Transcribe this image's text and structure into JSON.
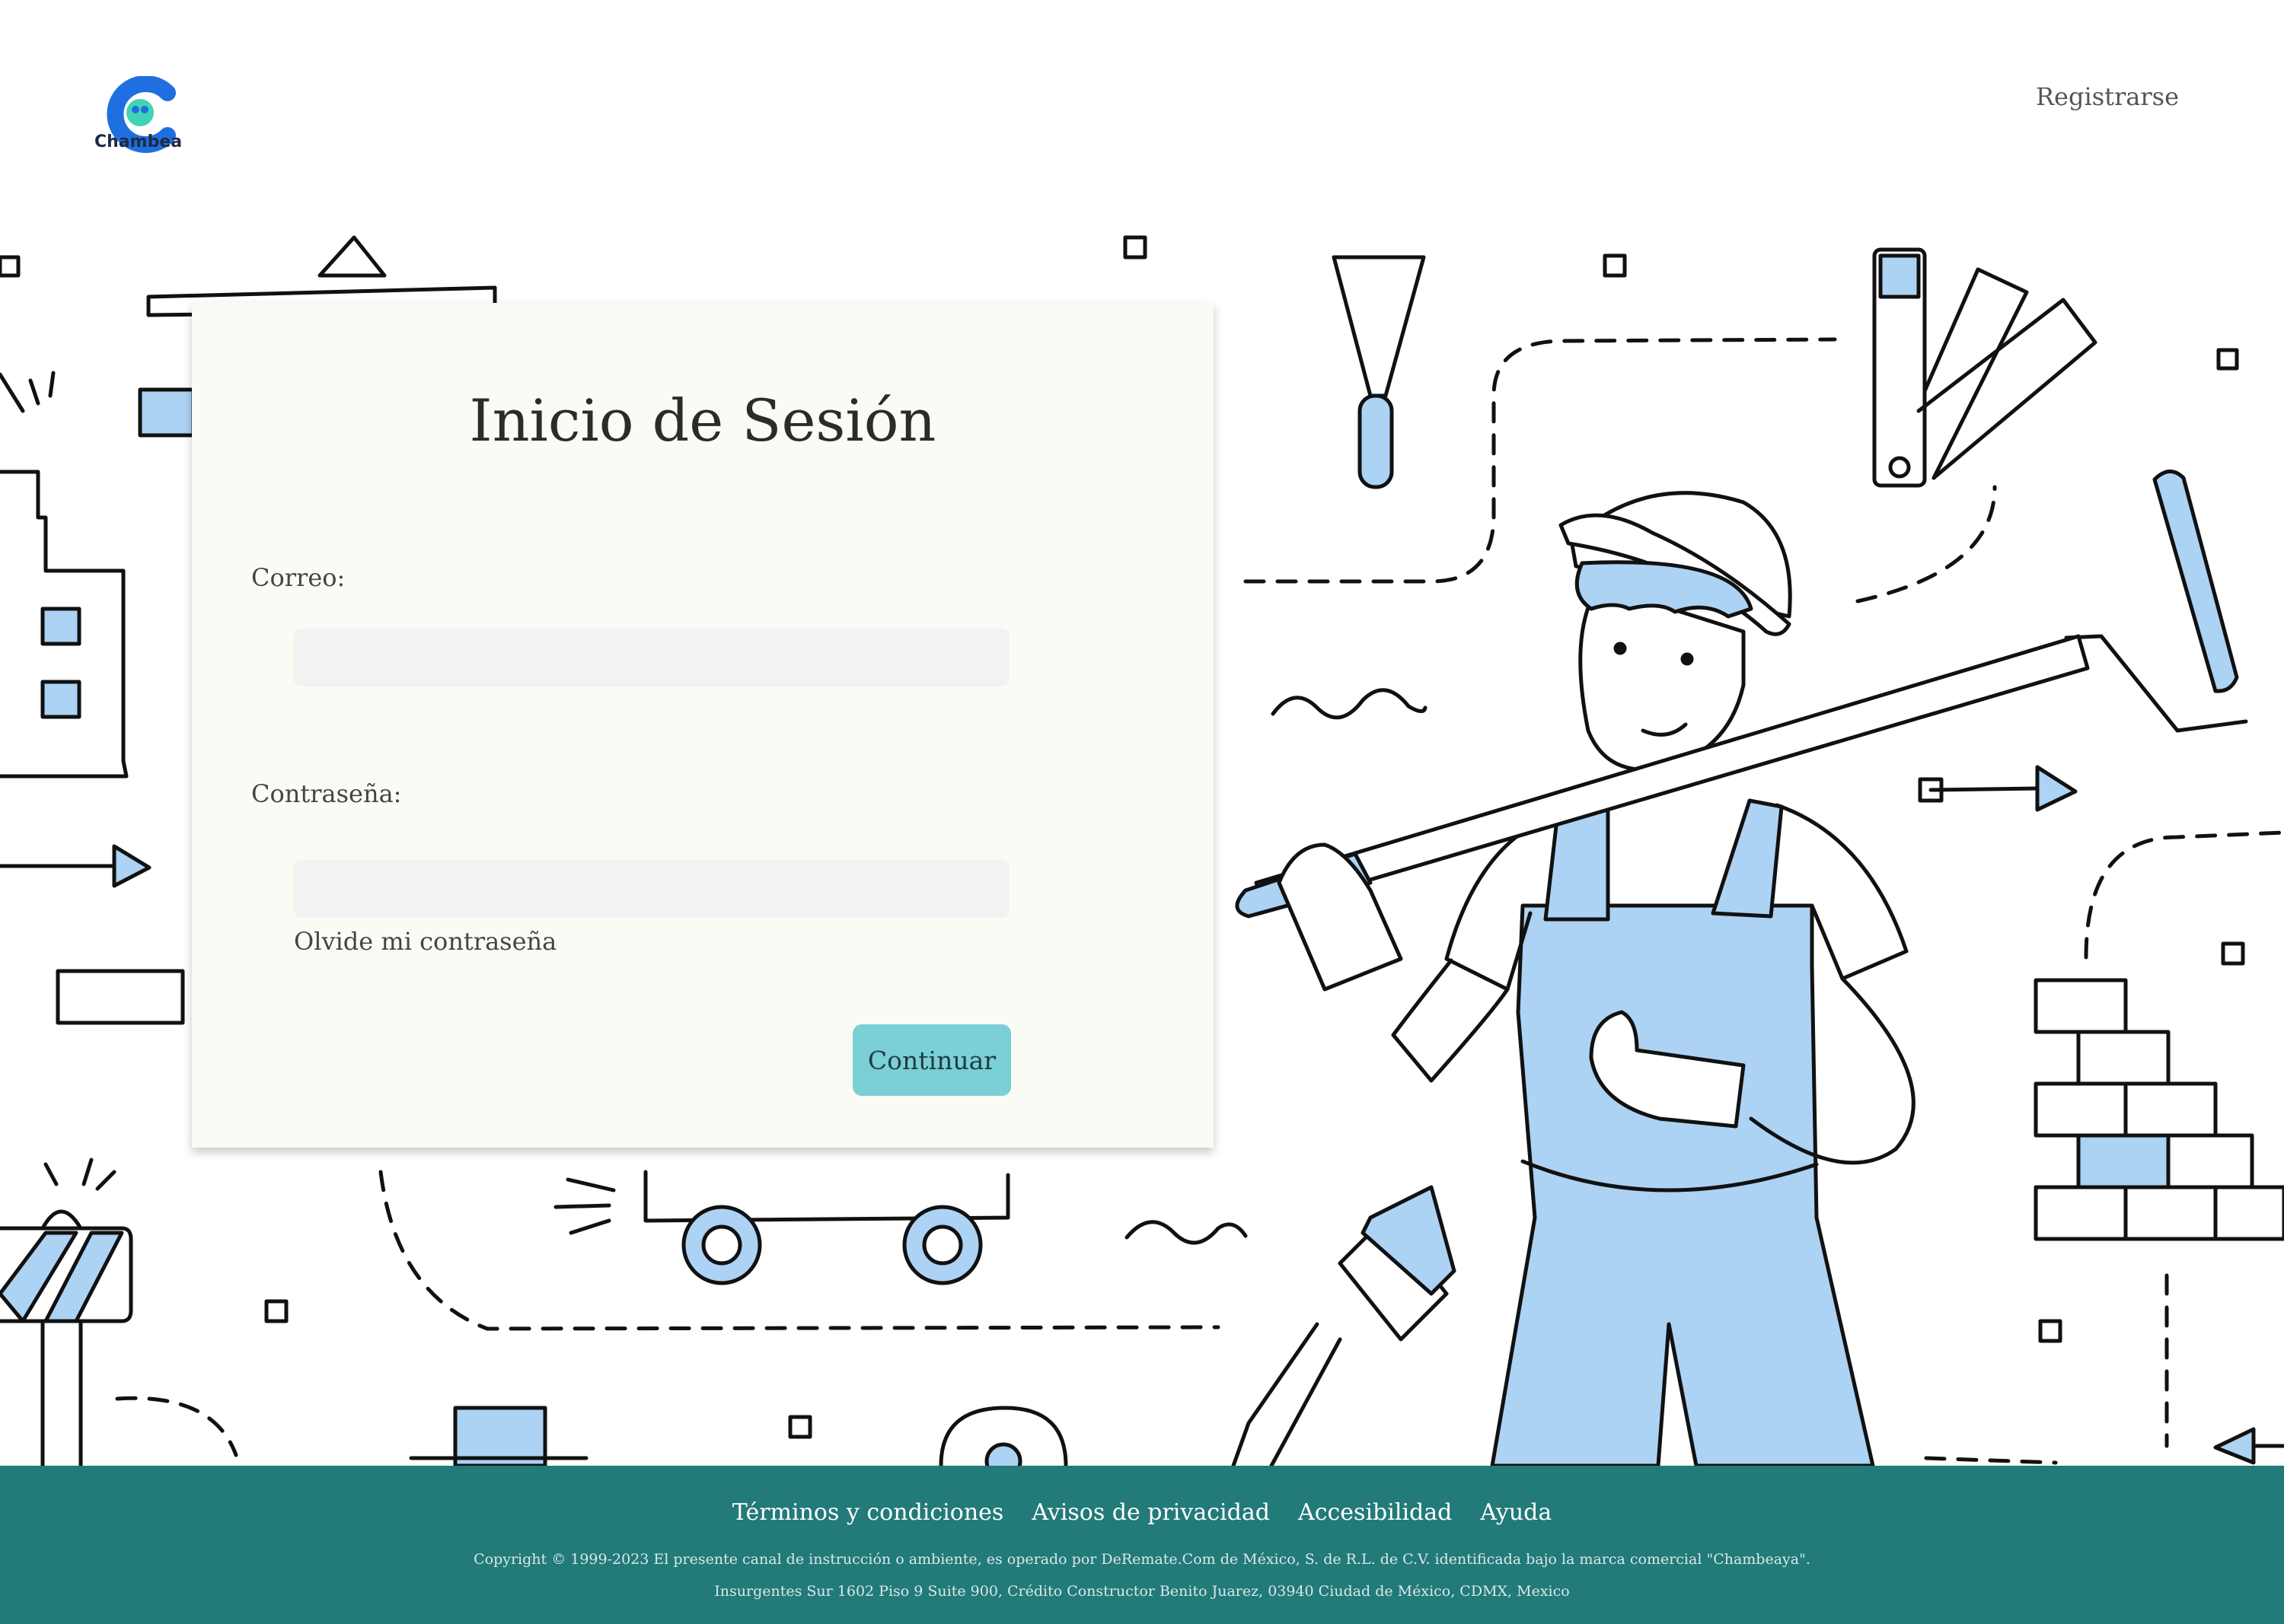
{
  "header": {
    "logo_text": "Chambea",
    "register_label": "Registrarse"
  },
  "login": {
    "title": "Inicio de Sesión",
    "email_label": "Correo:",
    "email_value": "",
    "password_label": "Contraseña:",
    "password_value": "",
    "forgot_label": "Olvide mi contraseña",
    "continue_label": "Continuar"
  },
  "footer": {
    "links": [
      "Términos y condiciones",
      "Avisos de privacidad",
      "Accesibilidad",
      "Ayuda"
    ],
    "copyright": "Copyright © 1999-2023 El presente canal de instrucción o ambiente, es operado por DeRemate.Com de México, S. de R.L. de C.V. identificada bajo la marca comercial \"Chambeaya\".",
    "address": "Insurgentes Sur 1602 Piso 9 Suite 900, Crédito Constructor Benito Juarez, 03940 Ciudad de México, CDMX, Mexico"
  },
  "colors": {
    "accent": "#7bcfd6",
    "footer_bg": "#227a79",
    "illustration_fill": "#acd2f4",
    "card_bg": "#fbfbf5"
  }
}
